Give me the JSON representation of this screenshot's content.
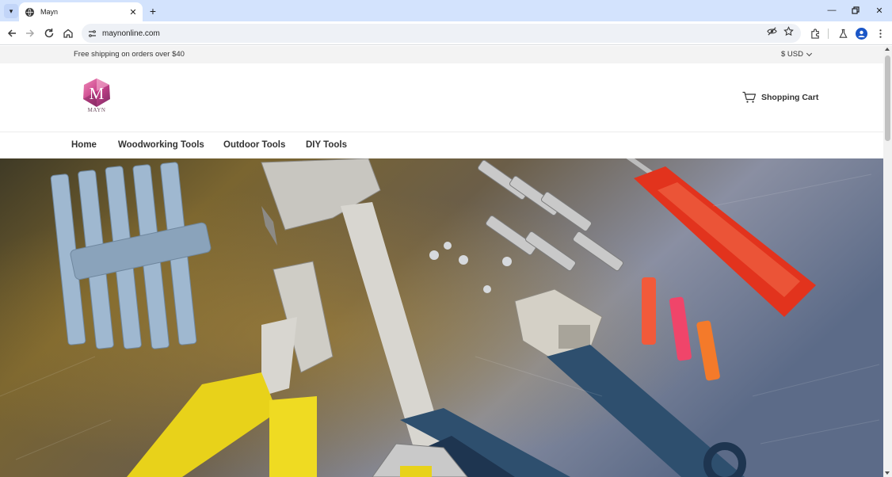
{
  "browser": {
    "tab_title": "Mayn",
    "url": "maynonline.com",
    "icons": [
      "tab-search-icon",
      "globe-favicon-icon",
      "close-icon",
      "plus-icon",
      "minimize-icon",
      "restore-icon",
      "close-window-icon",
      "back-arrow-icon",
      "forward-arrow-icon",
      "reload-icon",
      "home-icon",
      "site-info-icon",
      "eye-off-icon",
      "star-icon",
      "extensions-icon",
      "labs-flask-icon",
      "profile-icon",
      "kebab-menu-icon"
    ]
  },
  "announcement": {
    "shipping_text": "Free shipping on orders over $40",
    "currency": "$ USD"
  },
  "header": {
    "logo_letter": "M",
    "logo_text": "MAYN",
    "cart_label": "Shopping Cart"
  },
  "nav": {
    "items": [
      {
        "label": "Home"
      },
      {
        "label": "Woodworking Tools"
      },
      {
        "label": "Outdoor Tools"
      },
      {
        "label": "DIY Tools"
      }
    ]
  },
  "hero": {
    "subject": "tools-on-workbench",
    "colors": {
      "wood": "#6e5a2a",
      "metal": "#c9c9c9",
      "handle_blue": "#2e4f6e",
      "handle_red": "#e2331d",
      "handle_yellow": "#e8d21a"
    }
  }
}
